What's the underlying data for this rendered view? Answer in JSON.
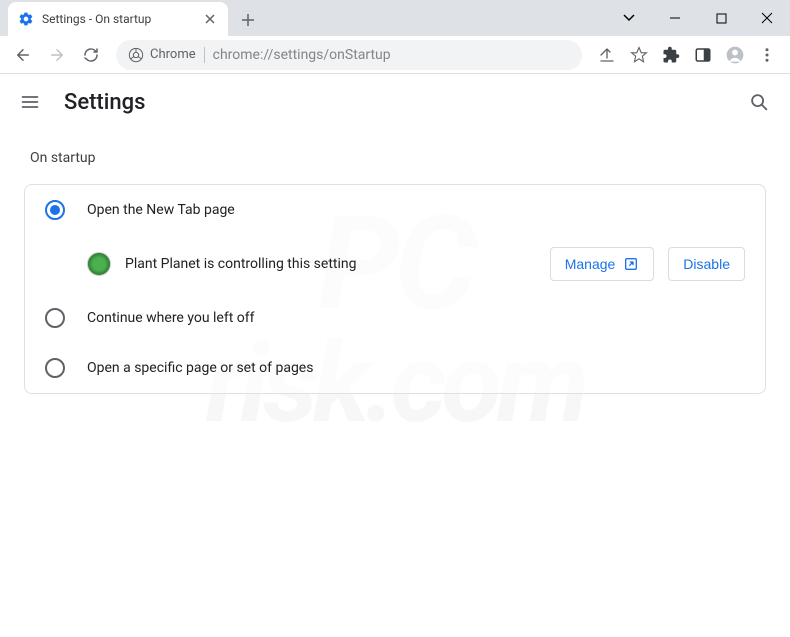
{
  "window": {
    "tab_title": "Settings - On startup"
  },
  "omnibox": {
    "chip_label": "Chrome",
    "url": "chrome://settings/onStartup"
  },
  "settings": {
    "title": "Settings",
    "section_title": "On startup",
    "options": [
      {
        "label": "Open the New Tab page",
        "selected": true
      },
      {
        "label": "Continue where you left off",
        "selected": false
      },
      {
        "label": "Open a specific page or set of pages",
        "selected": false
      }
    ],
    "extension_notice": {
      "name": "Plant Planet",
      "text": "Plant Planet is controlling this setting",
      "manage_label": "Manage",
      "disable_label": "Disable"
    }
  }
}
